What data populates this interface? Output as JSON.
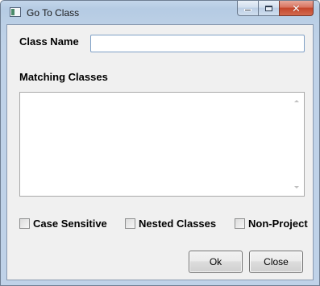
{
  "window": {
    "title": "Go To Class",
    "title_icon": "app-window-icon",
    "caption_buttons": {
      "minimize_icon": "minimize-icon",
      "maximize_icon": "maximize-icon",
      "close_icon": "close-icon",
      "close_glyph": "✕"
    }
  },
  "form": {
    "class_name_label": "Class Name",
    "class_name_value": "",
    "class_name_placeholder": "",
    "matching_label": "Matching Classes",
    "matching_items": []
  },
  "options": {
    "case_sensitive": {
      "label": "Case Sensitive",
      "checked": false
    },
    "nested_classes": {
      "label": "Nested Classes",
      "checked": false
    },
    "non_project": {
      "label": "Non-Project",
      "checked": false
    }
  },
  "buttons": {
    "ok": "Ok",
    "close": "Close"
  },
  "colors": {
    "accent_close": "#c4462b",
    "input_border": "#7fa0c6",
    "dialog_bg": "#f0f0f0"
  }
}
